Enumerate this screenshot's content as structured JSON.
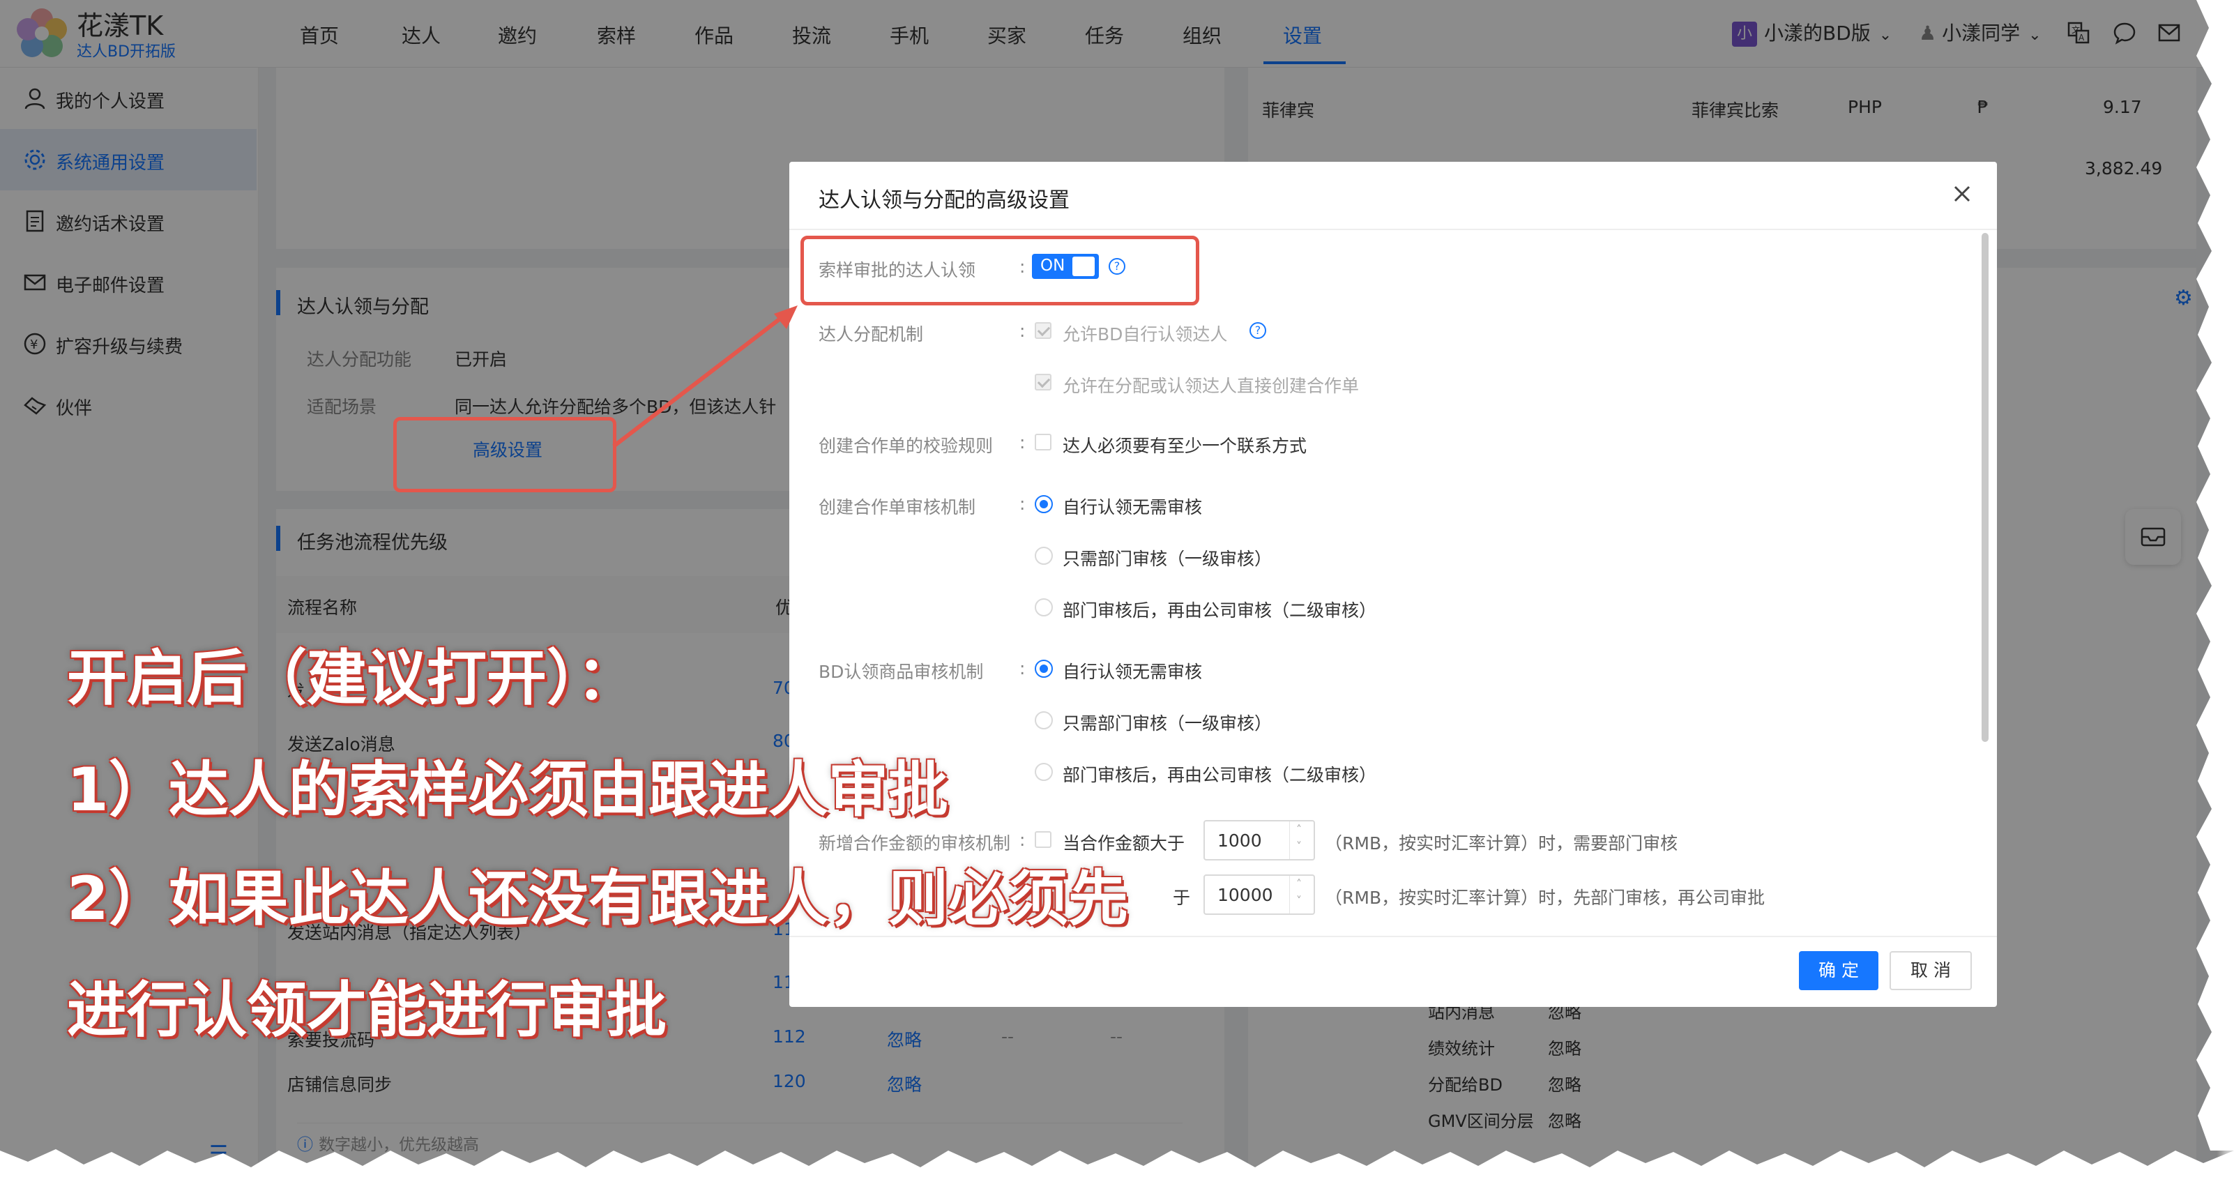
{
  "header": {
    "brand": "花漾TK",
    "brand_sub": "达人BD开拓版",
    "nav": [
      "首页",
      "达人",
      "邀约",
      "索样",
      "作品",
      "投流",
      "手机",
      "买家",
      "任务",
      "组织",
      "设置"
    ],
    "active_nav": "设置",
    "workspace": "小漾的BD版",
    "workspace_badge": "小",
    "user": "小漾同学"
  },
  "sidebar": {
    "items": [
      {
        "label": "我的个人设置",
        "icon": "user-icon"
      },
      {
        "label": "系统通用设置",
        "icon": "gear-icon"
      },
      {
        "label": "邀约话术设置",
        "icon": "document-icon"
      },
      {
        "label": "电子邮件设置",
        "icon": "mail-icon"
      },
      {
        "label": "扩容升级与续费",
        "icon": "yuan-icon"
      },
      {
        "label": "伙伴",
        "icon": "handshake-icon"
      }
    ]
  },
  "background": {
    "currency_row": {
      "country": "菲律宾",
      "name": "菲律宾比索",
      "code": "PHP",
      "symbol": "₱",
      "rate": "9.17"
    },
    "currency_value2": "3,882.49",
    "section1": {
      "title": "达人认领与分配",
      "rows": [
        {
          "label": "达人分配功能",
          "value": "已开启"
        },
        {
          "label": "适配场景",
          "value": "同一达人允许分配给多个BD，但该达人针"
        }
      ],
      "link": "高级设置"
    },
    "section2": {
      "title": "任务池流程优先级",
      "col1": "流程名称",
      "col2": "优",
      "rows": [
        {
          "name": "发",
          "prio": "70",
          "action": ""
        },
        {
          "name": "发送Zalo消息",
          "prio": "80",
          "action": ""
        },
        {
          "name": "发送站内消息（指定达人列表）",
          "prio": "11",
          "action": ""
        },
        {
          "name": "",
          "prio": "11",
          "action": ""
        },
        {
          "name": "索要投流码",
          "prio": "112",
          "action": "忽略",
          "c3": "--",
          "c4": "--"
        },
        {
          "name": "店铺信息同步",
          "prio": "120",
          "action": "忽略"
        }
      ],
      "footnote": "数字越小，优先级越高"
    },
    "right_list": [
      {
        "label": "站内消息",
        "value": "忽略"
      },
      {
        "label": "绩效统计",
        "value": "忽略"
      },
      {
        "label": "分配给BD",
        "value": "忽略"
      },
      {
        "label": "GMV区间分层",
        "value": "忽略"
      }
    ]
  },
  "modal": {
    "title": "达人认领与分配的高级设置",
    "rows": {
      "sample_approval": {
        "label": "索样审批的达人认领",
        "toggle": "ON"
      },
      "allocation": {
        "label": "达人分配机制",
        "opt1": "允许BD自行认领达人",
        "opt2": "允许在分配或认领达人直接创建合作单"
      },
      "validation": {
        "label": "创建合作单的校验规则",
        "opt1": "达人必须要有至少一个联系方式"
      },
      "create_review": {
        "label": "创建合作单审核机制",
        "opts": [
          "自行认领无需审核",
          "只需部门审核（一级审核）",
          "部门审核后，再由公司审核（二级审核）"
        ]
      },
      "bd_review": {
        "label": "BD认领商品审核机制",
        "opts": [
          "自行认领无需审核",
          "只需部门审核（一级审核）",
          "部门审核后，再由公司审核（二级审核）"
        ]
      },
      "amount_review": {
        "label": "新增合作金额的审核机制",
        "cb_label": "当合作金额大于",
        "v1": "1000",
        "t1": "（RMB，按实时汇率计算）时，需要部门审核",
        "v2": "10000",
        "t2": "（RMB，按实时汇率计算）时，先部门审核，再公司审批",
        "partial": "于"
      }
    },
    "ok": "确 定",
    "cancel": "取 消"
  },
  "annotation": {
    "line1": "开启后（建议打开）：",
    "line2": "1）达人的索样必须由跟进人审批",
    "line3": "2）如果此达人还没有跟进人，则必须先",
    "line4": "进行认领才能进行审批"
  },
  "colors": {
    "accent": "#1677ff",
    "annotation": "#e4574c"
  }
}
